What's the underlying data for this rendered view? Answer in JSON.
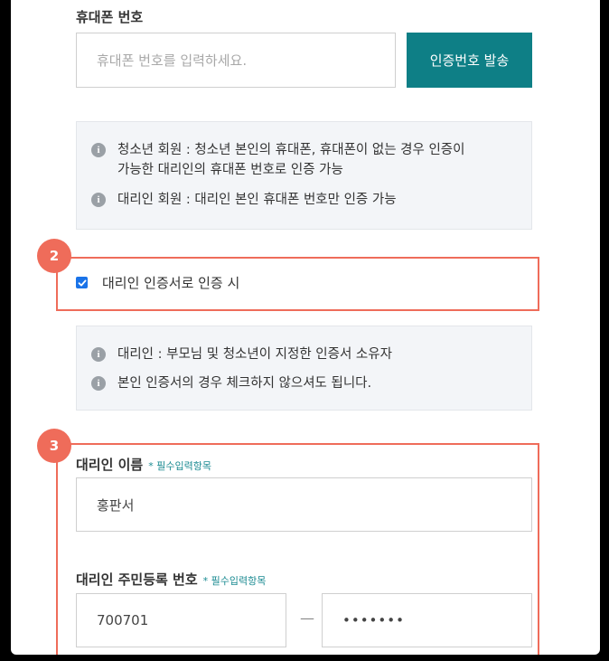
{
  "phone": {
    "label": "휴대폰 번호",
    "placeholder": "휴대폰 번호를 입력하세요.",
    "send_button": "인증번호 발송"
  },
  "info_box_1": {
    "items": [
      {
        "line1": "청소년 회원 : 청소년 본인의 휴대폰, 휴대폰이 없는 경우 인증이",
        "line2": "가능한 대리인의 휴대폰 번호로 인증 가능"
      },
      {
        "line1": "대리인 회원 : 대리인 본인 휴대폰 번호만 인증 가능",
        "line2": ""
      }
    ]
  },
  "step2": {
    "marker": "2",
    "checkbox_label": "대리인 인증서로 인증 시",
    "checked": true
  },
  "info_box_2": {
    "items": [
      {
        "line1": "대리인 : 부모님 및 청소년이 지정한 인증서 소유자"
      },
      {
        "line1": "본인 인증서의 경우 체크하지 않으셔도 됩니다."
      }
    ]
  },
  "step3": {
    "marker": "3",
    "name_label": "대리인 이름",
    "name_required": "* 필수입력항목",
    "name_value": "홍판서",
    "rrn_label": "대리인 주민등록 번호",
    "rrn_required": "* 필수입력항목",
    "rrn_front": "700701",
    "rrn_separator": "—",
    "rrn_back": "•••••••"
  },
  "colors": {
    "accent": "#0e7f86",
    "highlight": "#ef6c5a",
    "info_bg": "#f3f5f8"
  },
  "icons": {
    "info": "info-circle-icon",
    "check": "checkmark-icon"
  }
}
